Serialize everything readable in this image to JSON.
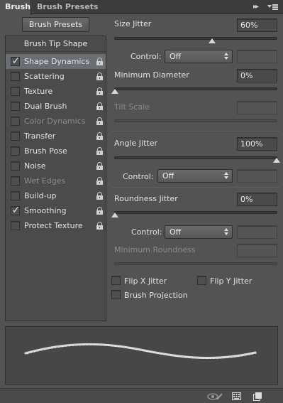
{
  "tabs": [
    {
      "label": "Brush",
      "active": true
    },
    {
      "label": "Brush Presets",
      "active": false
    }
  ],
  "left": {
    "presets_button": "Brush Presets",
    "tip_shape": "Brush Tip Shape",
    "options": [
      {
        "label": "Shape Dynamics",
        "checked": true,
        "selected": true,
        "disabled": false,
        "lock": true
      },
      {
        "label": "Scattering",
        "checked": false,
        "selected": false,
        "disabled": false,
        "lock": true
      },
      {
        "label": "Texture",
        "checked": false,
        "selected": false,
        "disabled": false,
        "lock": true
      },
      {
        "label": "Dual Brush",
        "checked": false,
        "selected": false,
        "disabled": false,
        "lock": true
      },
      {
        "label": "Color Dynamics",
        "checked": false,
        "selected": false,
        "disabled": true,
        "lock": true
      },
      {
        "label": "Transfer",
        "checked": false,
        "selected": false,
        "disabled": false,
        "lock": true
      },
      {
        "label": "Brush Pose",
        "checked": false,
        "selected": false,
        "disabled": false,
        "lock": true
      },
      {
        "label": "Noise",
        "checked": false,
        "selected": false,
        "disabled": false,
        "lock": true
      },
      {
        "label": "Wet Edges",
        "checked": false,
        "selected": false,
        "disabled": true,
        "lock": true
      },
      {
        "label": "Build-up",
        "checked": false,
        "selected": false,
        "disabled": false,
        "lock": true
      },
      {
        "label": "Smoothing",
        "checked": true,
        "selected": false,
        "disabled": false,
        "lock": true
      },
      {
        "label": "Protect Texture",
        "checked": false,
        "selected": false,
        "disabled": false,
        "lock": true
      }
    ]
  },
  "size_jitter": {
    "label": "Size Jitter",
    "value": "60%",
    "level": 0.6
  },
  "control1": {
    "label": "Control:",
    "value": "Off"
  },
  "min_diameter": {
    "label": "Minimum Diameter",
    "value": "0%",
    "level": 0
  },
  "tilt_scale": {
    "label": "Tilt Scale"
  },
  "angle_jitter": {
    "label": "Angle Jitter",
    "value": "100%",
    "level": 1.0
  },
  "control2": {
    "label": "Control:",
    "value": "Off"
  },
  "roundness_jitter": {
    "label": "Roundness Jitter",
    "value": "0%",
    "level": 0
  },
  "control3": {
    "label": "Control:",
    "value": "Off"
  },
  "min_roundness": {
    "label": "Minimum Roundness"
  },
  "flip_x": {
    "label": "Flip X Jitter",
    "checked": false
  },
  "flip_y": {
    "label": "Flip Y Jitter",
    "checked": false
  },
  "brush_projection": {
    "label": "Brush Projection",
    "checked": false
  },
  "icons": {
    "collapse": "double-chevron-right-icon",
    "menu": "panel-menu-icon",
    "footer": [
      "eye-brush-toggle-icon",
      "grid-icon",
      "new-preset-icon"
    ]
  }
}
